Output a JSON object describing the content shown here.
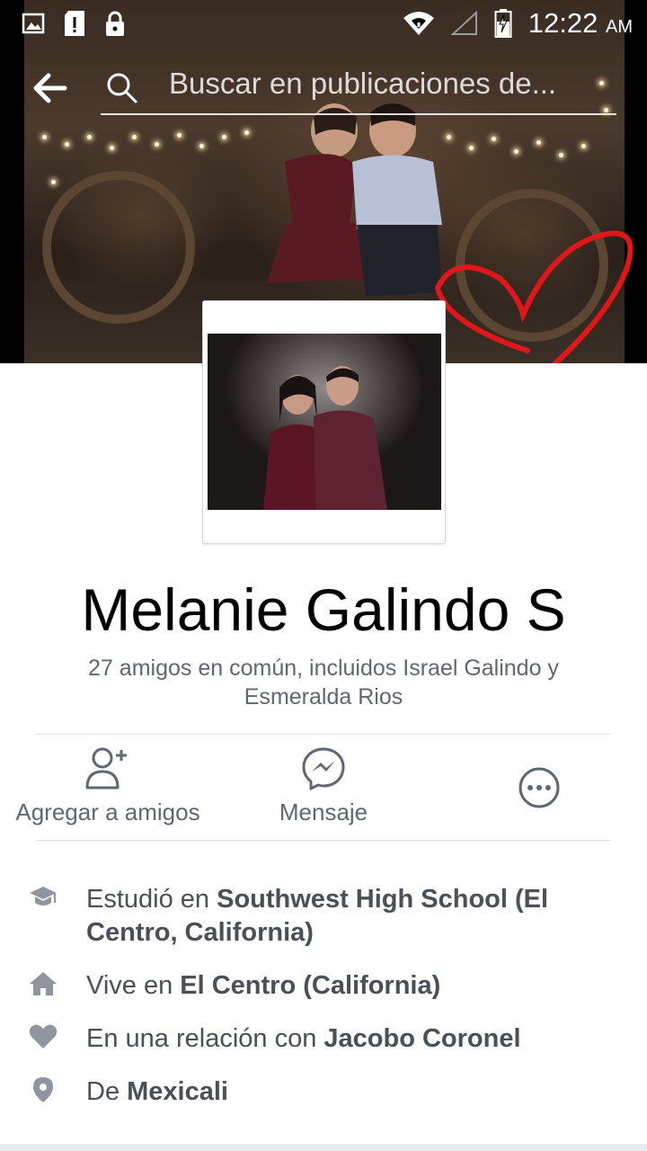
{
  "status_bar": {
    "time": "12:22",
    "ampm": "AM",
    "icons": [
      "image-icon",
      "sd-card-alert-icon",
      "lock-icon",
      "wifi-icon",
      "signal-icon",
      "battery-charging-icon"
    ]
  },
  "search": {
    "placeholder": "Buscar en publicaciones de..."
  },
  "profile": {
    "name": "Melanie Galindo S",
    "mutual_friends": "27 amigos en común, incluidos Israel Galindo y Esmeralda Rios"
  },
  "actions": {
    "add_friend": "Agregar a amigos",
    "message": "Mensaje"
  },
  "intro": [
    {
      "icon": "graduation-cap-icon",
      "prefix": "Estudió en ",
      "bold": "Southwest High School (El Centro, California)"
    },
    {
      "icon": "home-icon",
      "prefix": "Vive en ",
      "bold": "El Centro (California)"
    },
    {
      "icon": "heart-icon",
      "prefix": "En una relación con ",
      "bold": "Jacobo Coronel"
    },
    {
      "icon": "location-pin-icon",
      "prefix": "De ",
      "bold": "Mexicali"
    }
  ],
  "colors": {
    "icon_gray": "#90949c",
    "text_gray": "#616770",
    "divider": "#dddfe2",
    "heart_red": "#e0161b"
  }
}
